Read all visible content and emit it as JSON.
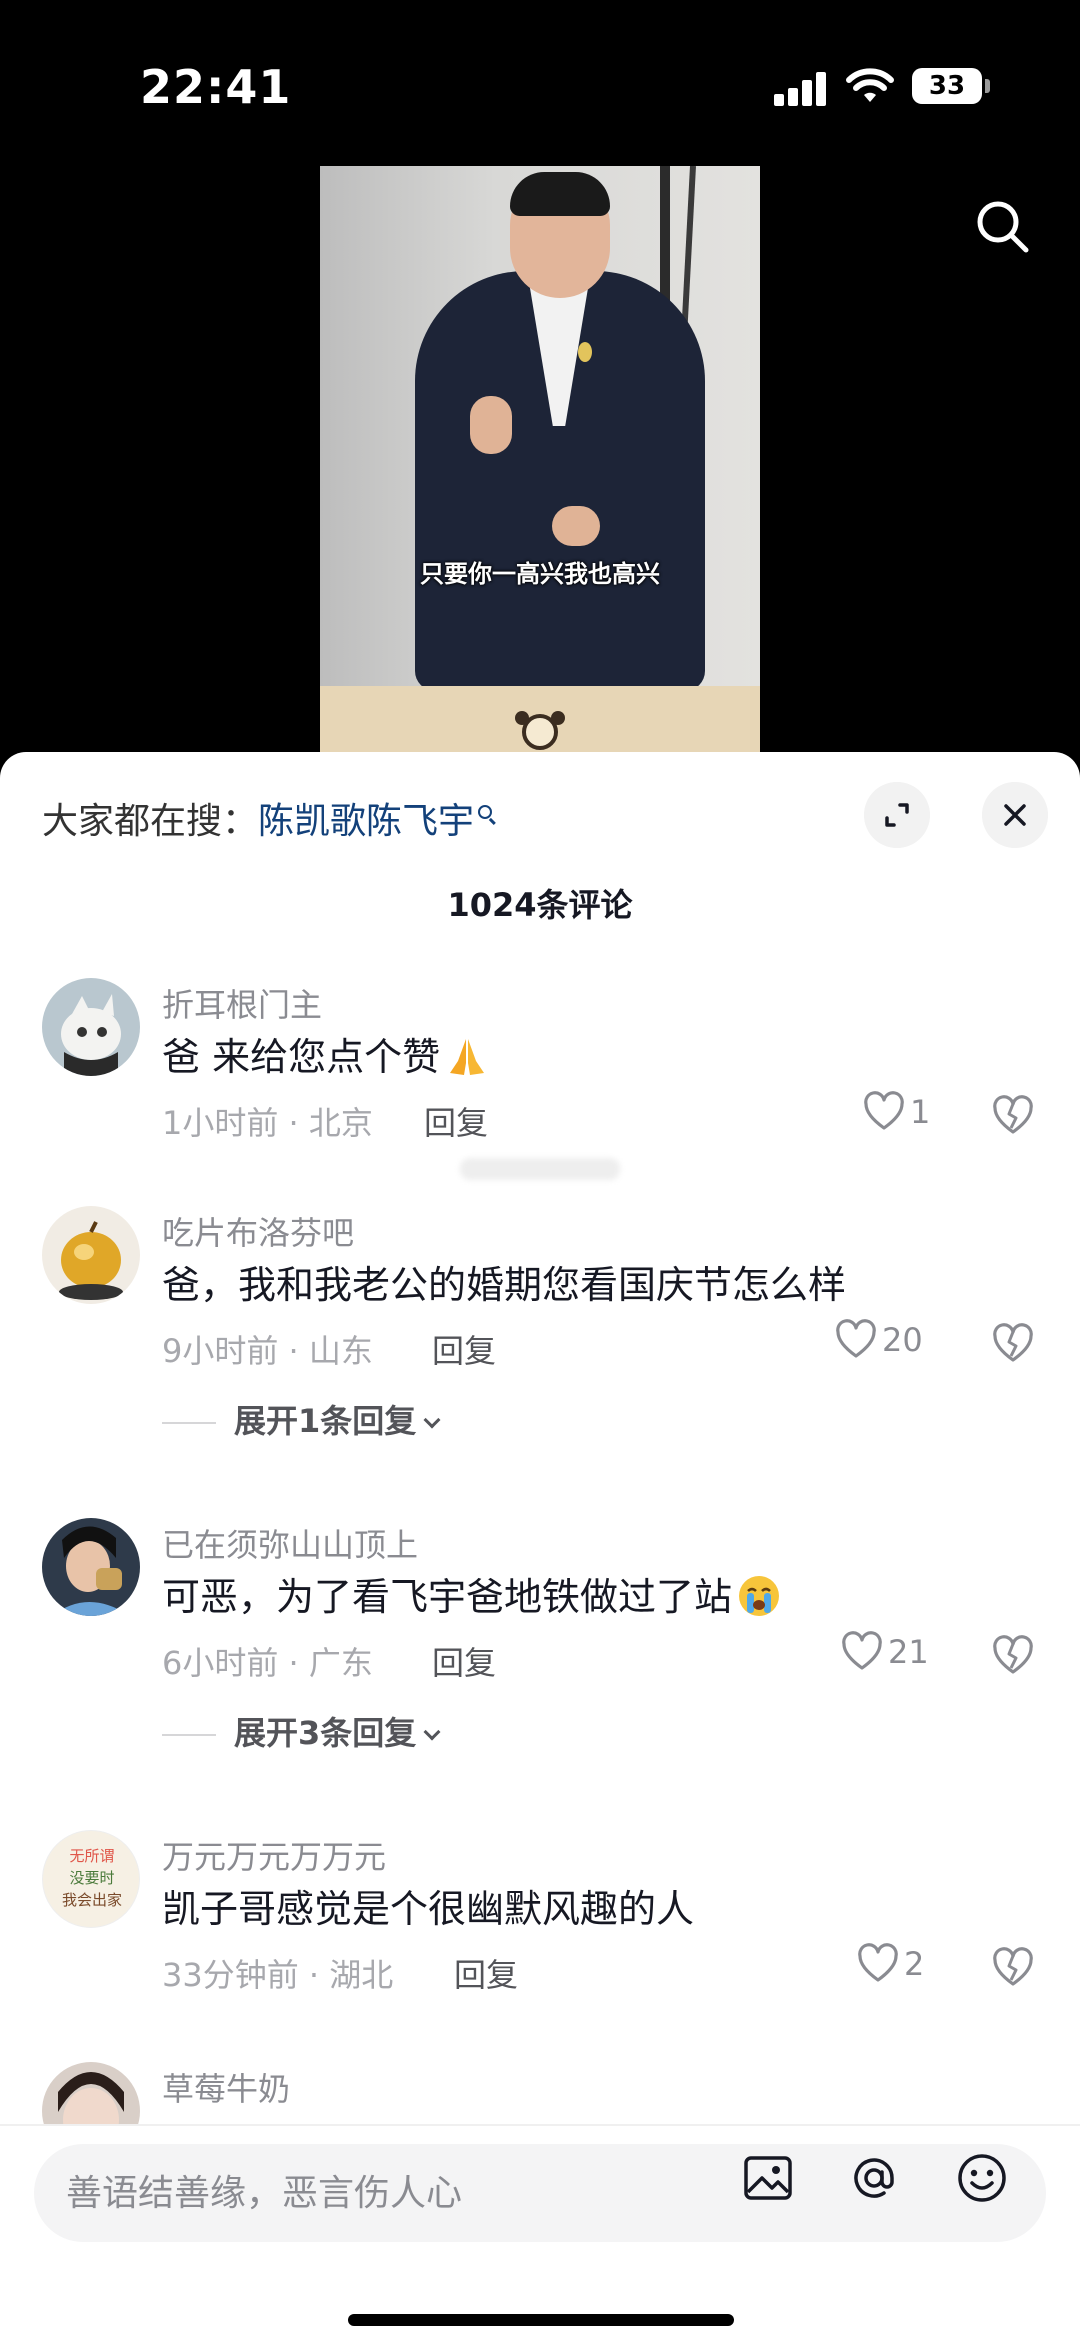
{
  "status_bar": {
    "time": "22:41",
    "battery": "33"
  },
  "video": {
    "subtitle": "只要你一高兴我也高兴"
  },
  "sheet": {
    "hot_search_label": "大家都在搜：",
    "hot_search_keyword": "陈凯歌陈飞宇",
    "comment_count": "1024条评论",
    "reply_label": "回复",
    "comments": [
      {
        "username": "折耳根门主",
        "text": "爸 来给您点个赞",
        "emoji": "pray",
        "meta": "1小时前 · 北京",
        "likes": "1"
      },
      {
        "username": "吃片布洛芬吧",
        "text": "爸，我和我老公的婚期您看国庆节怎么样",
        "meta": "9小时前 · 山东",
        "likes": "20",
        "expand": "展开1条回复"
      },
      {
        "username": "已在须弥山山顶上",
        "text": "可恶，为了看飞宇爸地铁做过了站",
        "emoji": "crying",
        "meta": "6小时前 · 广东",
        "likes": "21",
        "expand": "展开3条回复"
      },
      {
        "username": "万元万元万万元",
        "text": "凯子哥感觉是个很幽默风趣的人",
        "meta": "33分钟前 · 湖北",
        "likes": "2"
      },
      {
        "username": "草莓牛奶"
      }
    ],
    "avatar_4_text": [
      "无所谓",
      "没要时",
      "我会出家"
    ]
  },
  "input_bar": {
    "placeholder": "善语结善缘，恶言伤人心"
  },
  "icons": [
    "search-icon",
    "expand-icon",
    "close-icon",
    "heart-icon",
    "dislike-icon",
    "chevron-down-icon",
    "image-icon",
    "at-icon",
    "emoji-icon"
  ],
  "colors": {
    "keyword": "#13417a",
    "muted": "#8a8b91",
    "text": "#161823"
  }
}
